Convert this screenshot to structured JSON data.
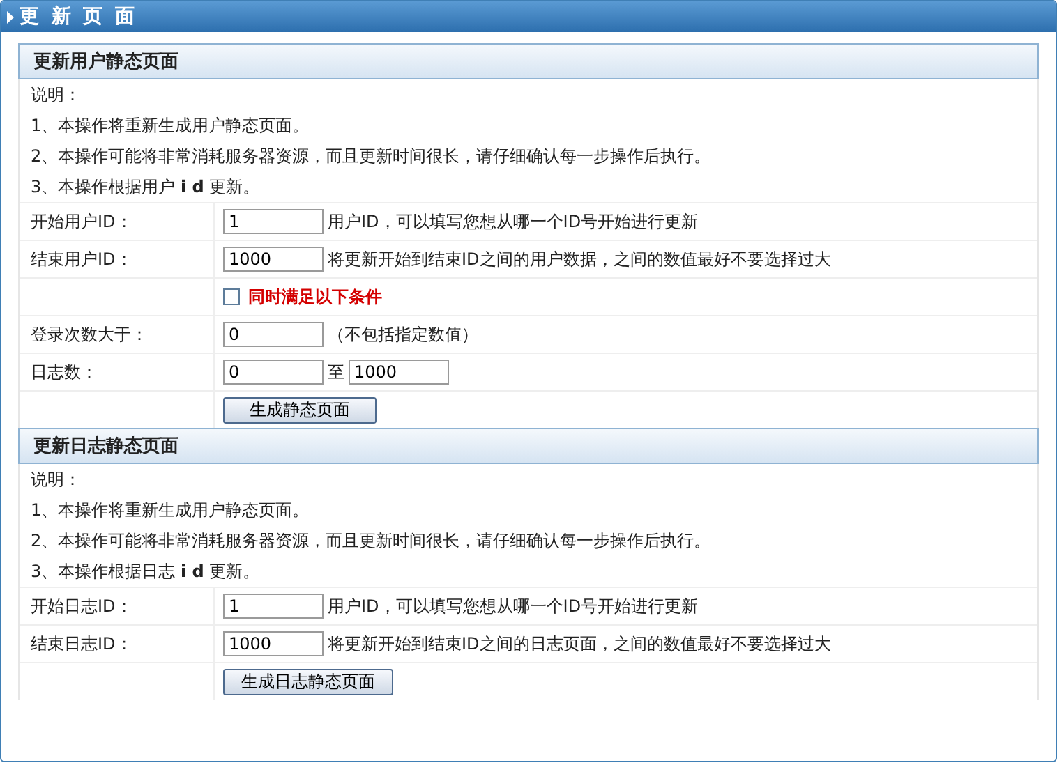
{
  "window": {
    "title": "更 新 页 面"
  },
  "sections": [
    {
      "title": "更新用户静态页面",
      "notes": [
        "说明：",
        "1、本操作将重新生成用户静态页面。",
        "2、本操作可能将非常消耗服务器资源，而且更新时间很长，请仔细确认每一步操作后执行。",
        "3、本操作根据用户 **i d** 更新。"
      ],
      "rows": [
        {
          "kind": "field",
          "label": "开始用户ID：",
          "value": "1",
          "hint": "用户ID，可以填写您想从哪一个ID号开始进行更新"
        },
        {
          "kind": "field",
          "label": "结束用户ID：",
          "value": "1000",
          "hint": "将更新开始到结束ID之间的用户数据，之间的数值最好不要选择过大"
        },
        {
          "kind": "checkbox",
          "text": "同时满足以下条件",
          "checked": false
        },
        {
          "kind": "field",
          "label": "登录次数大于：",
          "value": "0",
          "hint": "（不包括指定数值）"
        },
        {
          "kind": "range",
          "label": "日志数：",
          "from": "0",
          "separator": "至",
          "to": "1000"
        },
        {
          "kind": "button",
          "text": "生成静态页面"
        }
      ]
    },
    {
      "title": "更新日志静态页面",
      "notes": [
        "说明：",
        "1、本操作将重新生成用户静态页面。",
        "2、本操作可能将非常消耗服务器资源，而且更新时间很长，请仔细确认每一步操作后执行。",
        "3、本操作根据日志 **i d** 更新。"
      ],
      "rows": [
        {
          "kind": "field",
          "label": "开始日志ID：",
          "value": "1",
          "hint": "用户ID，可以填写您想从哪一个ID号开始进行更新"
        },
        {
          "kind": "field",
          "label": "结束日志ID：",
          "value": "1000",
          "hint": "将更新开始到结束ID之间的日志页面，之间的数值最好不要选择过大"
        },
        {
          "kind": "button",
          "text": "生成日志静态页面"
        }
      ]
    }
  ]
}
